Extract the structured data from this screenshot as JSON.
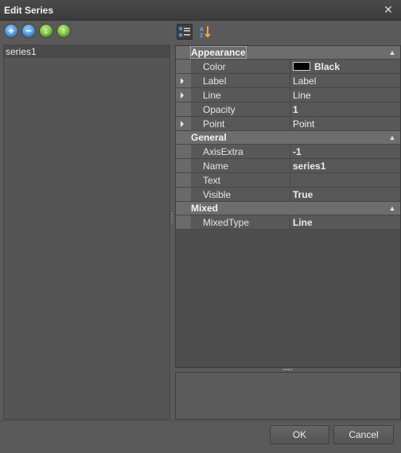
{
  "window": {
    "title": "Edit Series"
  },
  "toolbar": {
    "buttons": [
      {
        "icon": "add-icon",
        "glyph": "+",
        "color": "#2c7fd6"
      },
      {
        "icon": "remove-icon",
        "glyph": "−",
        "color": "#2c7fd6"
      },
      {
        "icon": "move-down-icon",
        "glyph": "↓",
        "color": "#4e9b12"
      },
      {
        "icon": "move-up-icon",
        "glyph": "↑",
        "color": "#4e9b12"
      }
    ]
  },
  "series_list": {
    "items": [
      "series1"
    ]
  },
  "property_grid": {
    "toolbar": {
      "categorized_icon": "categorized-view-icon",
      "alphabetical_icon": "alphabetical-sort-icon"
    },
    "categories": [
      {
        "name": "Appearance",
        "rows": [
          {
            "name": "Color",
            "value": "Black",
            "swatch": "#000000",
            "bold": true,
            "expandable": false
          },
          {
            "name": "Label",
            "value": "Label",
            "bold": false,
            "expandable": true
          },
          {
            "name": "Line",
            "value": "Line",
            "bold": false,
            "expandable": true
          },
          {
            "name": "Opacity",
            "value": "1",
            "bold": true,
            "expandable": false
          },
          {
            "name": "Point",
            "value": "Point",
            "bold": false,
            "expandable": true
          }
        ]
      },
      {
        "name": "General",
        "rows": [
          {
            "name": "AxisExtra",
            "value": "-1",
            "bold": true,
            "expandable": false
          },
          {
            "name": "Name",
            "value": "series1",
            "bold": true,
            "expandable": false
          },
          {
            "name": "Text",
            "value": "",
            "bold": false,
            "expandable": false
          },
          {
            "name": "Visible",
            "value": "True",
            "bold": true,
            "expandable": false
          }
        ]
      },
      {
        "name": "Mixed",
        "rows": [
          {
            "name": "MixedType",
            "value": "Line",
            "bold": true,
            "expandable": false
          }
        ]
      }
    ]
  },
  "footer": {
    "ok_label": "OK",
    "cancel_label": "Cancel"
  }
}
